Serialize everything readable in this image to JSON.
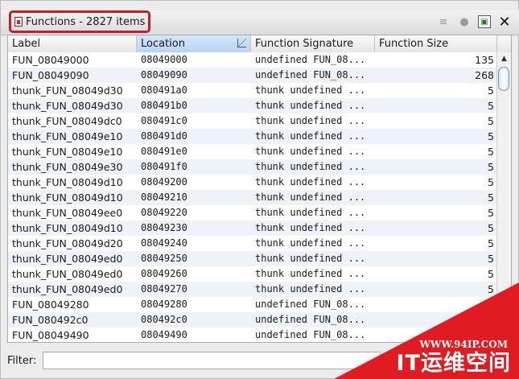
{
  "window": {
    "title": "Functions - 2827 items"
  },
  "toolbar": {
    "icons": [
      "menu-lines-icon",
      "settings-cog-icon",
      "snapshot-icon",
      "close-icon"
    ],
    "close_label": "✕"
  },
  "table": {
    "columns": [
      "Label",
      "Location",
      "Function Signature",
      "Function Size"
    ],
    "sorted_column": "Location",
    "rows": [
      [
        "FUN_08049000",
        "08049000",
        "undefined FUN_08...",
        "135"
      ],
      [
        "FUN_08049090",
        "08049090",
        "undefined FUN_08...",
        "268"
      ],
      [
        "thunk_FUN_08049d30",
        "080491a0",
        "thunk undefined ...",
        "5"
      ],
      [
        "thunk_FUN_08049d30",
        "080491b0",
        "thunk undefined ...",
        "5"
      ],
      [
        "thunk_FUN_08049dc0",
        "080491c0",
        "thunk undefined ...",
        "5"
      ],
      [
        "thunk_FUN_08049e10",
        "080491d0",
        "thunk undefined ...",
        "5"
      ],
      [
        "thunk_FUN_08049e10",
        "080491e0",
        "thunk undefined ...",
        "5"
      ],
      [
        "thunk_FUN_08049e30",
        "080491f0",
        "thunk undefined ...",
        "5"
      ],
      [
        "thunk_FUN_08049d10",
        "08049200",
        "thunk undefined ...",
        "5"
      ],
      [
        "thunk_FUN_08049d10",
        "08049210",
        "thunk undefined ...",
        "5"
      ],
      [
        "thunk_FUN_08049ee0",
        "08049220",
        "thunk undefined ...",
        "5"
      ],
      [
        "thunk_FUN_08049d10",
        "08049230",
        "thunk undefined ...",
        "5"
      ],
      [
        "thunk_FUN_08049d20",
        "08049240",
        "thunk undefined ...",
        "5"
      ],
      [
        "thunk_FUN_08049ed0",
        "08049250",
        "thunk undefined ...",
        "5"
      ],
      [
        "thunk_FUN_08049ed0",
        "08049260",
        "thunk undefined ...",
        "5"
      ],
      [
        "thunk_FUN_08049ed0",
        "08049270",
        "thunk undefined ...",
        "5"
      ],
      [
        "FUN_08049280",
        "08049280",
        "undefined FUN_08...",
        "5"
      ],
      [
        "FUN_080492c0",
        "080492c0",
        "undefined FUN_08...",
        ""
      ],
      [
        "FUN_08049490",
        "08049490",
        "undefined FUN_08...",
        ""
      ]
    ]
  },
  "filter": {
    "label": "Filter:",
    "value": ""
  },
  "watermark": {
    "url": "WWW.94IP.COM",
    "name": "IT运维空间"
  },
  "colors": {
    "highlight_border": "#c0202a",
    "sorted_header": "#c8ddf6",
    "watermark": "#e01b22"
  }
}
